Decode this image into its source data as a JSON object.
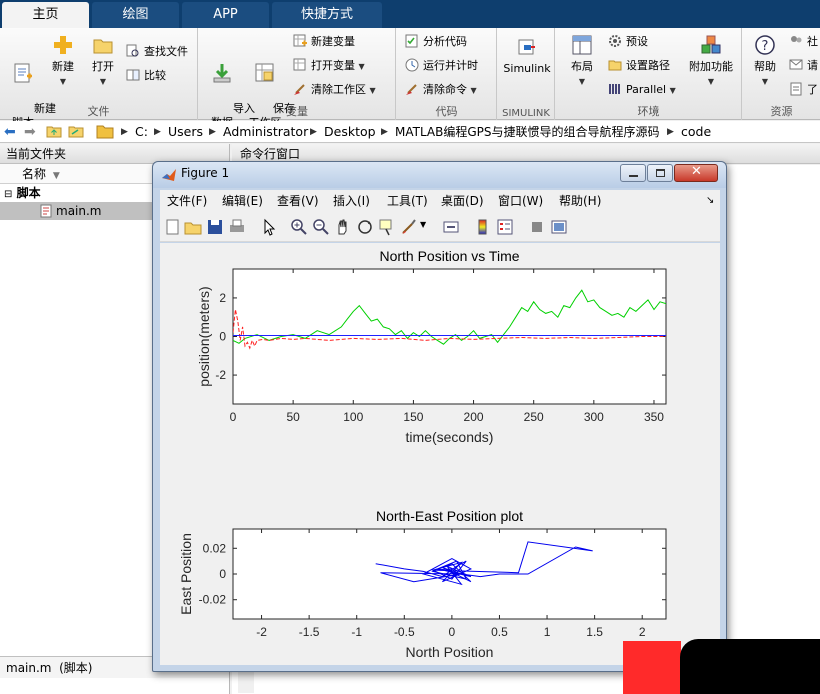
{
  "tabs": [
    "主页",
    "绘图",
    "APP",
    "快捷方式"
  ],
  "ribbon": {
    "file": {
      "new_script": "新建\n脚本",
      "new": "新建",
      "open": "打开",
      "find_files": "查找文件",
      "compare": "比较",
      "label": "文件"
    },
    "variable": {
      "import_data": "导入\n数据",
      "save_workspace": "保存\n工作区",
      "new_variable": "新建变量",
      "open_variable": "打开变量",
      "clear_workspace": "清除工作区",
      "label": "变量"
    },
    "code": {
      "analyze": "分析代码",
      "run_time": "运行并计时",
      "clear_commands": "清除命令",
      "label": "代码"
    },
    "simulink": {
      "button": "Simulink",
      "label": "SIMULINK"
    },
    "env": {
      "layout": "布局",
      "preferences": "预设",
      "set_path": "设置路径",
      "parallel": "Parallel",
      "addons": "附加功能",
      "label": "环境"
    },
    "resources": {
      "help": "帮助",
      "community": "社",
      "request": "请",
      "learn": "了",
      "label": "资源"
    }
  },
  "address": {
    "crumbs": [
      "C:",
      "Users",
      "Administrator",
      "Desktop",
      "MATLAB编程GPS与捷联惯导的组合导航程序源码",
      "code"
    ]
  },
  "file_pane": {
    "title": "当前文件夹",
    "col_name": "名称",
    "group": "脚本",
    "file": "main.m",
    "status": "main.m  (脚本)"
  },
  "command_window": {
    "title": "命令行窗口"
  },
  "figure": {
    "title": "Figure 1",
    "menus": [
      "文件(F)",
      "编辑(E)",
      "查看(V)",
      "插入(I)",
      "工具(T)",
      "桌面(D)",
      "窗口(W)",
      "帮助(H)"
    ]
  },
  "chart_data": [
    {
      "type": "line",
      "title": "North Position vs Time",
      "xlabel": "time(seconds)",
      "ylabel": "position(meters)",
      "xlim": [
        0,
        360
      ],
      "ylim": [
        -3.5,
        3.5
      ],
      "xticks": [
        0,
        50,
        100,
        150,
        200,
        250,
        300,
        350
      ],
      "yticks": [
        -2,
        0,
        2
      ],
      "series": [
        {
          "color": "#00d000",
          "style": "solid",
          "x": [
            0,
            5,
            10,
            20,
            30,
            40,
            50,
            60,
            70,
            80,
            90,
            95,
            100,
            105,
            110,
            115,
            120,
            125,
            130,
            135,
            140,
            145,
            150,
            155,
            160,
            165,
            170,
            175,
            180,
            185,
            190,
            195,
            200,
            205,
            210,
            215,
            220,
            225,
            230,
            235,
            240,
            245,
            250,
            255,
            260,
            265,
            270,
            275,
            280,
            285,
            290,
            295,
            300,
            305,
            310,
            315,
            320,
            325,
            330,
            335,
            340,
            345,
            350,
            355,
            360
          ],
          "y": [
            -0.2,
            -0.35,
            -0.1,
            0.1,
            -0.2,
            0.0,
            0.1,
            -0.1,
            0.3,
            0.1,
            0.5,
            0.9,
            1.3,
            1.6,
            1.2,
            0.8,
            0.9,
            0.5,
            0.4,
            0.1,
            0.3,
            -0.1,
            0.2,
            0.0,
            0.3,
            0.0,
            -0.2,
            -0.4,
            -0.1,
            0.1,
            -0.2,
            0.0,
            0.3,
            -0.1,
            0.0,
            0.1,
            -0.3,
            0.1,
            0.5,
            1.0,
            1.5,
            1.3,
            1.8,
            1.4,
            1.2,
            1.3,
            1.0,
            1.6,
            1.5,
            2.0,
            2.4,
            1.8,
            1.9,
            1.5,
            1.3,
            1.1,
            1.2,
            1.0,
            1.5,
            1.3,
            1.6,
            1.9,
            1.4,
            1.8,
            1.7
          ]
        },
        {
          "color": "#ff2020",
          "style": "dashed",
          "x": [
            0,
            2,
            4,
            6,
            8,
            10,
            12,
            14,
            16,
            18,
            20,
            25,
            30,
            40,
            50,
            60,
            80,
            100,
            120,
            140,
            160,
            180,
            200,
            220,
            240,
            260,
            280,
            300,
            320,
            340,
            360
          ],
          "y": [
            0.2,
            1.4,
            0.8,
            -0.2,
            0.5,
            -0.5,
            -0.3,
            -0.6,
            -0.2,
            -0.5,
            -0.2,
            -0.15,
            -0.2,
            -0.1,
            -0.15,
            -0.1,
            -0.2,
            -0.1,
            -0.15,
            -0.1,
            -0.2,
            -0.1,
            -0.15,
            -0.1,
            -0.05,
            -0.1,
            -0.05,
            -0.1,
            -0.05,
            0.0,
            0.0
          ]
        },
        {
          "color": "#2020ff",
          "style": "solid",
          "x": [
            0,
            360
          ],
          "y": [
            0.05,
            0.05
          ]
        }
      ]
    },
    {
      "type": "line",
      "title": "North-East Position plot",
      "xlabel": "North Position",
      "ylabel": "East Position",
      "xlim": [
        -2.3,
        2.25
      ],
      "ylim": [
        -0.035,
        0.035
      ],
      "xticks": [
        -2,
        -1.5,
        -1,
        -0.5,
        0,
        0.5,
        1,
        1.5,
        2
      ],
      "yticks": [
        -0.02,
        0,
        0.02
      ],
      "series": [
        {
          "color": "#0000ee",
          "style": "solid",
          "x": [
            -0.8,
            -0.5,
            -0.3,
            -0.1,
            0.05,
            0.15,
            0.0,
            -0.2,
            0.1,
            -0.1,
            0.2,
            0.0,
            -0.3,
            0.1,
            -0.05,
            0.2,
            -0.15,
            0.05,
            0.15,
            -0.2,
            0.0,
            0.2,
            -0.1,
            0.1,
            -0.4,
            -0.75,
            0.1,
            0.3,
            0.5,
            0.8,
            1.3,
            1.48,
            0.8,
            0.7,
            -0.2,
            0.0
          ],
          "y": [
            0.008,
            0.004,
            0.002,
            -0.002,
            0.006,
            0.01,
            -0.004,
            0.003,
            0.009,
            -0.006,
            0.004,
            0.012,
            0.0,
            -0.008,
            0.006,
            -0.002,
            0.004,
            0.01,
            -0.004,
            0.002,
            0.008,
            -0.006,
            0.005,
            0.0,
            -0.006,
            0.001,
            0.0,
            -0.002,
            0.0,
            0.0,
            0.021,
            0.018,
            0.025,
            0.001,
            0.003,
            0.004
          ]
        }
      ]
    }
  ]
}
